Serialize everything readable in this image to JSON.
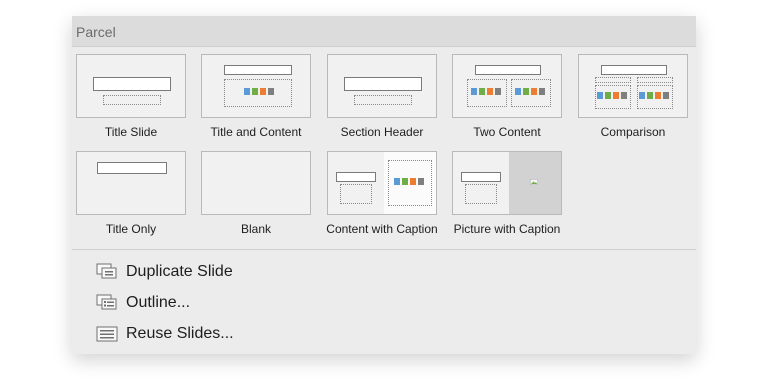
{
  "section": {
    "title": "Parcel"
  },
  "layouts": [
    {
      "label": "Title Slide"
    },
    {
      "label": "Title and Content"
    },
    {
      "label": "Section Header"
    },
    {
      "label": "Two Content"
    },
    {
      "label": "Comparison"
    },
    {
      "label": "Title Only"
    },
    {
      "label": "Blank"
    },
    {
      "label": "Content with Caption"
    },
    {
      "label": "Picture with Caption"
    }
  ],
  "menu": {
    "duplicate": "Duplicate Slide",
    "outline": "Outline...",
    "reuse": "Reuse Slides..."
  },
  "colors": {
    "icon_blue": "#5b9bd5",
    "icon_green": "#70ad47",
    "icon_orange": "#ed7d31"
  }
}
